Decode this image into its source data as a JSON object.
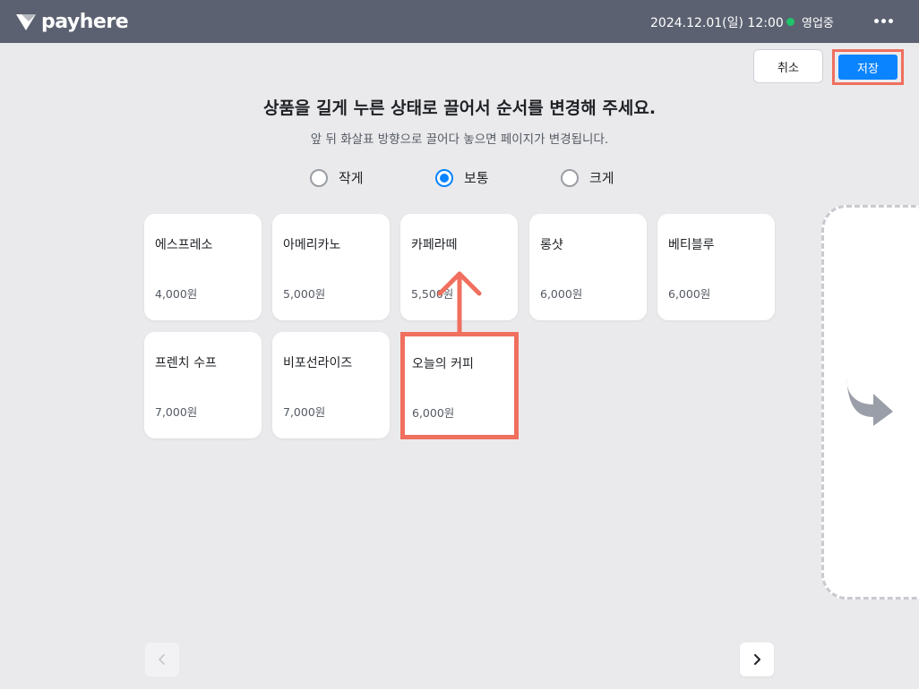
{
  "header": {
    "logo_text": "payhere",
    "datetime": "2024.12.01(일) 12:00",
    "status": "영업중",
    "status_color": "#1fc46b"
  },
  "actions": {
    "cancel_label": "취소",
    "save_label": "저장"
  },
  "instructions": {
    "title": "상품을 길게 누른 상태로 끌어서 순서를 변경해 주세요.",
    "subtitle": "앞 뒤 화살표 방향으로 끌어다 놓으면 페이지가 변경됩니다."
  },
  "size_options": [
    {
      "label": "작게",
      "selected": false
    },
    {
      "label": "보통",
      "selected": true
    },
    {
      "label": "크게",
      "selected": false
    }
  ],
  "products": [
    {
      "name": "에스프레소",
      "price": "4,000원"
    },
    {
      "name": "아메리카노",
      "price": "5,000원"
    },
    {
      "name": "카페라떼",
      "price": "5,500원"
    },
    {
      "name": "롱샷",
      "price": "6,000원"
    },
    {
      "name": "베티블루",
      "price": "6,000원"
    },
    {
      "name": "프렌치 수프",
      "price": "7,000원"
    },
    {
      "name": "비포선라이즈",
      "price": "7,000원"
    },
    {
      "name": "오늘의 커피",
      "price": "6,000원"
    }
  ],
  "colors": {
    "accent": "#0a84ff",
    "highlight": "#f06f5e",
    "topbar": "#5b6170"
  }
}
